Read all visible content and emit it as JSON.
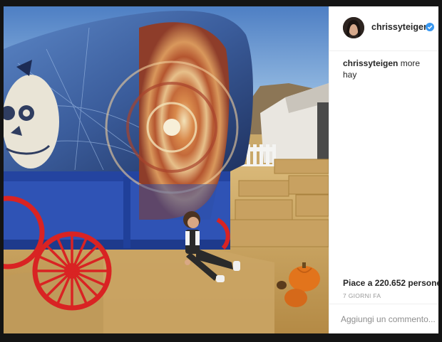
{
  "post": {
    "username": "chrissyteigen",
    "verified": true,
    "caption_user": "chrissyteigen",
    "caption_text": " more hay",
    "likes_label": "Piace a 220.652 persone",
    "time_ago": "7 GIORNI FA",
    "comment_placeholder": "Aggiungi un commento..."
  },
  "icons": {
    "verified": "verified-badge-icon"
  },
  "colors": {
    "verified_badge": "#3897f0",
    "username": "#262626",
    "muted": "#999999"
  }
}
